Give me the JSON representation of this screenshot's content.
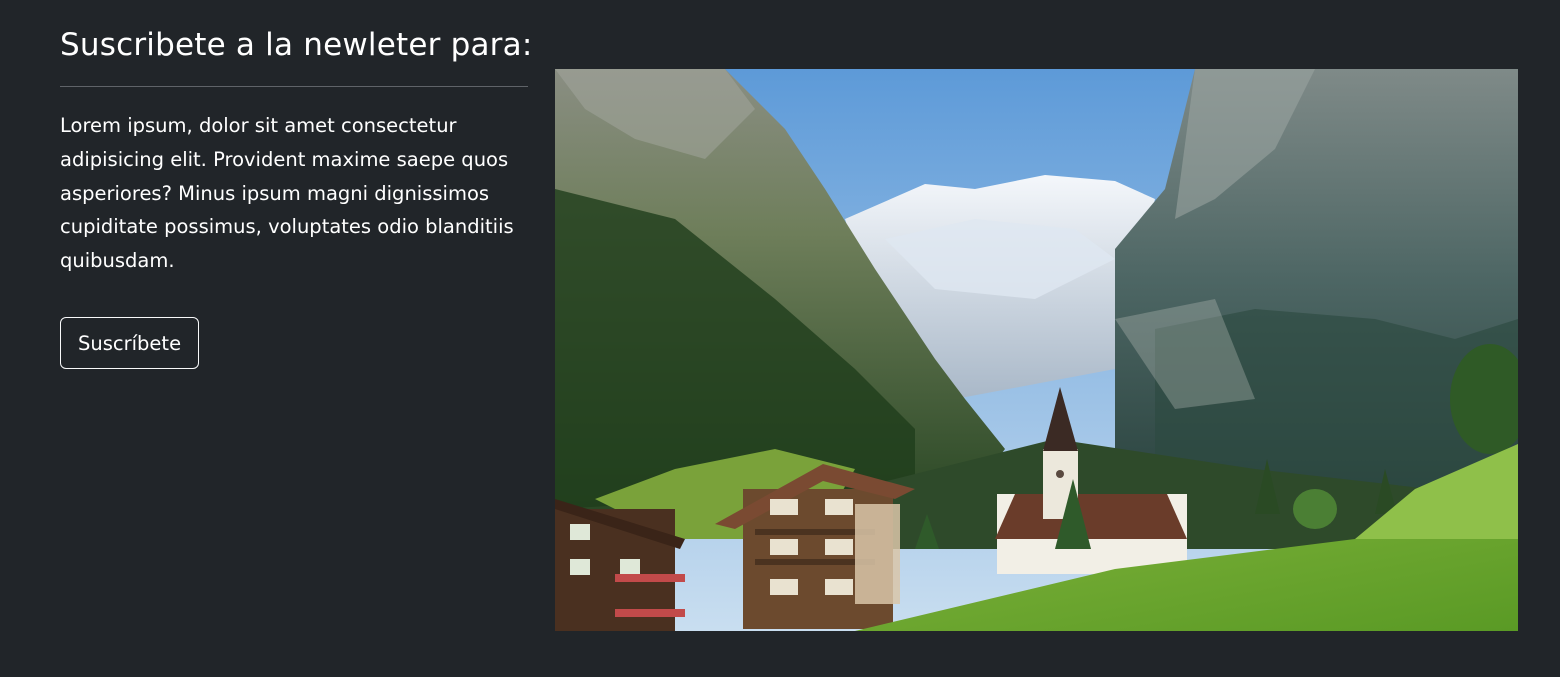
{
  "newsletter": {
    "title": "Suscribete a la newleter para:",
    "description": "Lorem ipsum, dolor sit amet consectetur adipisicing elit. Provident maxime saepe quos asperiores? Minus ipsum magni dignissimos cupiditate possimus, voluptates odio blanditiis quibusdam.",
    "button_label": "Suscríbete"
  },
  "image": {
    "subject": "alpine-valley-village-photo"
  },
  "colors": {
    "background": "#212529",
    "text": "#ffffff",
    "divider": "#5f6368",
    "button_border": "#f8f9fa"
  }
}
